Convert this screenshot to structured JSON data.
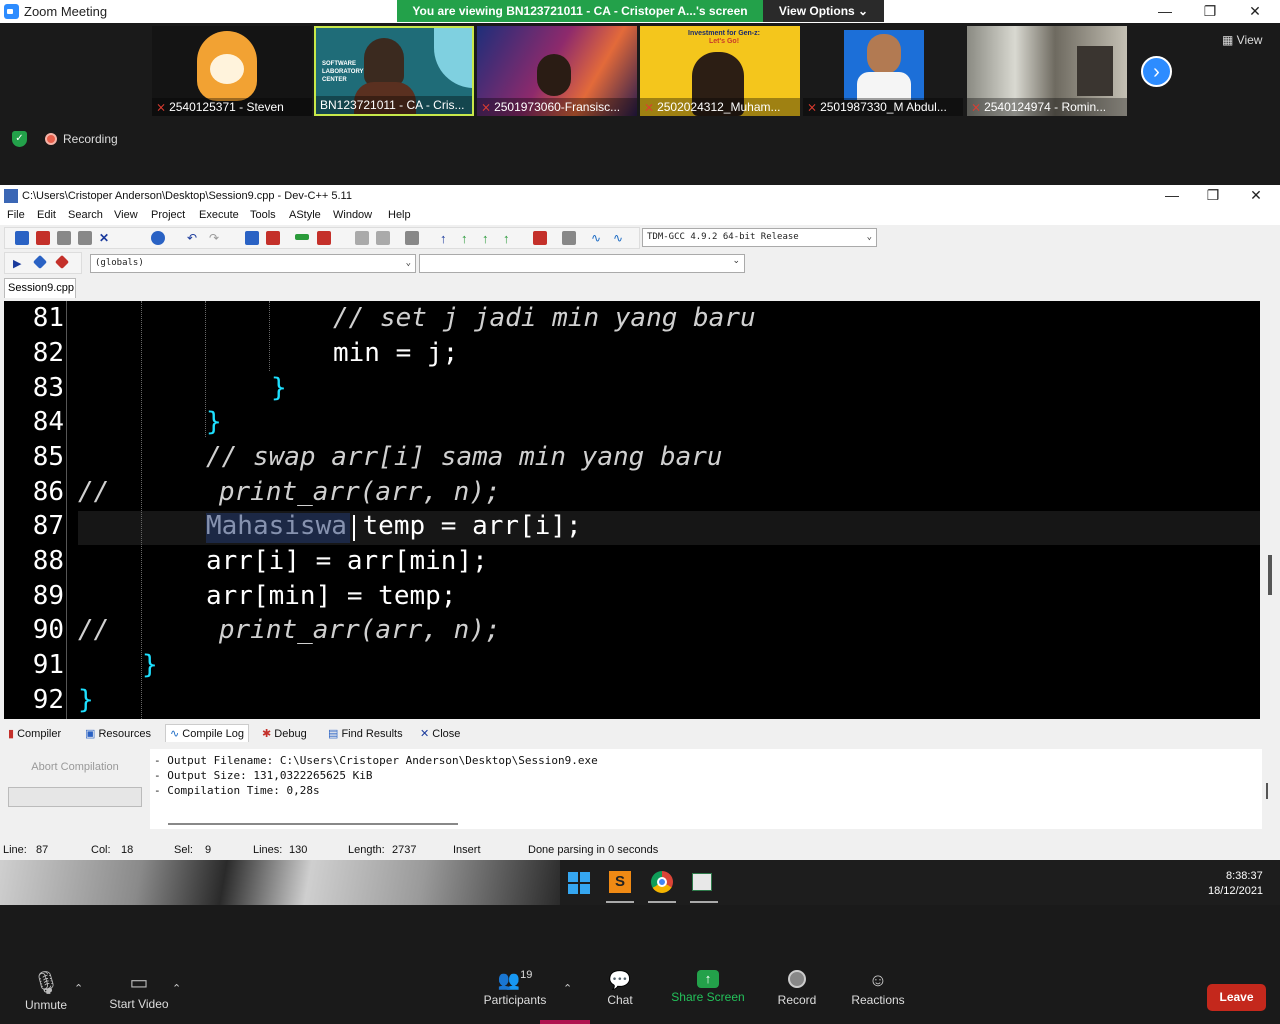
{
  "zoom": {
    "window_title": "Zoom Meeting",
    "viewing_banner": "You are viewing BN123721011 - CA - Cristoper A...'s screen",
    "view_options": "View Options ⌄",
    "view_label": "View",
    "recording_label": "Recording",
    "participants": [
      {
        "name": "2540125371 - Steven",
        "muted": true
      },
      {
        "name": "BN123721011 - CA - Cris...",
        "muted": false
      },
      {
        "name": "2501973060-Fransisc...",
        "muted": true
      },
      {
        "name": "2502024312_Muham...",
        "muted": true
      },
      {
        "name": "2501987330_M Abdul...",
        "muted": true
      },
      {
        "name": "2540124974 - Romin...",
        "muted": true
      }
    ],
    "thumb_texts": {
      "lab_line1": "SOFTWARE",
      "lab_line2": "LABORATORY",
      "lab_line3": "CENTER",
      "gen_z_line1": "Investment for Gen-z:",
      "gen_z_line2": "Let's Go!"
    },
    "toolbar": {
      "unmute": "Unmute",
      "start_video": "Start Video",
      "participants": "Participants",
      "participants_count": "19",
      "chat": "Chat",
      "share_screen": "Share Screen",
      "record": "Record",
      "reactions": "Reactions",
      "leave": "Leave"
    }
  },
  "devcpp": {
    "window_title": "C:\\Users\\Cristoper Anderson\\Desktop\\Session9.cpp - Dev-C++ 5.11",
    "menu": [
      "File",
      "Edit",
      "Search",
      "View",
      "Project",
      "Execute",
      "Tools",
      "AStyle",
      "Window",
      "Help"
    ],
    "compiler_select": "TDM-GCC 4.9.2 64-bit Release",
    "globals_select": "(globals)",
    "file_tab": "Session9.cpp",
    "code_lines": [
      {
        "no": "81",
        "text": "// set j jadi min yang baru"
      },
      {
        "no": "82",
        "text": "min = j;"
      },
      {
        "no": "83",
        "text": "}"
      },
      {
        "no": "84",
        "text": "}"
      },
      {
        "no": "85",
        "text": "// swap arr[i] sama min yang baru"
      },
      {
        "no": "86",
        "text": "//       print_arr(arr, n);"
      },
      {
        "no": "87",
        "text": "Mahasiswa temp = arr[i];"
      },
      {
        "no": "88",
        "text": "arr[i] = arr[min];"
      },
      {
        "no": "89",
        "text": "arr[min] = temp;"
      },
      {
        "no": "90",
        "text": "//       print_arr(arr, n);"
      },
      {
        "no": "91",
        "text": "}"
      },
      {
        "no": "92",
        "text": "}"
      }
    ],
    "panel_tabs": [
      "Compiler",
      "Resources",
      "Compile Log",
      "Debug",
      "Find Results",
      "Close"
    ],
    "active_panel_tab": "Compile Log",
    "abort_button": "Abort Compilation",
    "compile_log": [
      "- Output Filename: C:\\Users\\Cristoper Anderson\\Desktop\\Session9.exe",
      "- Output Size: 131,0322265625 KiB",
      "- Compilation Time: 0,28s"
    ],
    "status": {
      "line_label": "Line:",
      "line": "87",
      "col_label": "Col:",
      "col": "18",
      "sel_label": "Sel:",
      "sel": "9",
      "lines_label": "Lines:",
      "lines": "130",
      "length_label": "Length:",
      "length": "2737",
      "mode": "Insert",
      "message": "Done parsing in 0 seconds"
    }
  },
  "taskbar": {
    "time": "8:38:37",
    "date": "18/12/2021"
  },
  "colors": {
    "zoom_green": "#23a14a",
    "zoom_blue": "#2d8cff",
    "leave_red": "#c4281c",
    "code_symbol": "#1ee0ff",
    "selection": "#23386e"
  }
}
